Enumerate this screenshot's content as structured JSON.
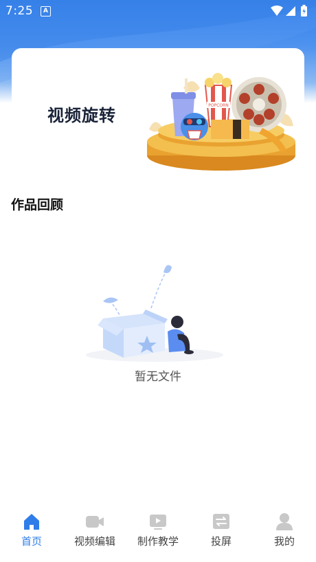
{
  "status_bar": {
    "time": "7:25",
    "notification_badge": "A"
  },
  "banner": {
    "title": "视频旋转",
    "popcorn_text": "POPCORN"
  },
  "section": {
    "title": "作品回顾"
  },
  "empty_state": {
    "text": "暂无文件"
  },
  "bottom_nav": {
    "items": [
      {
        "label": "首页",
        "icon": "home-icon",
        "active": true
      },
      {
        "label": "视频编辑",
        "icon": "video-camera-icon",
        "active": false
      },
      {
        "label": "制作教学",
        "icon": "tutorial-play-icon",
        "active": false
      },
      {
        "label": "投屏",
        "icon": "cast-screen-icon",
        "active": false
      },
      {
        "label": "我的",
        "icon": "profile-icon",
        "active": false
      }
    ]
  },
  "colors": {
    "accent": "#2f7de9",
    "inactive_icon": "#c8c8c8",
    "banner_gold": "#e9a230"
  }
}
